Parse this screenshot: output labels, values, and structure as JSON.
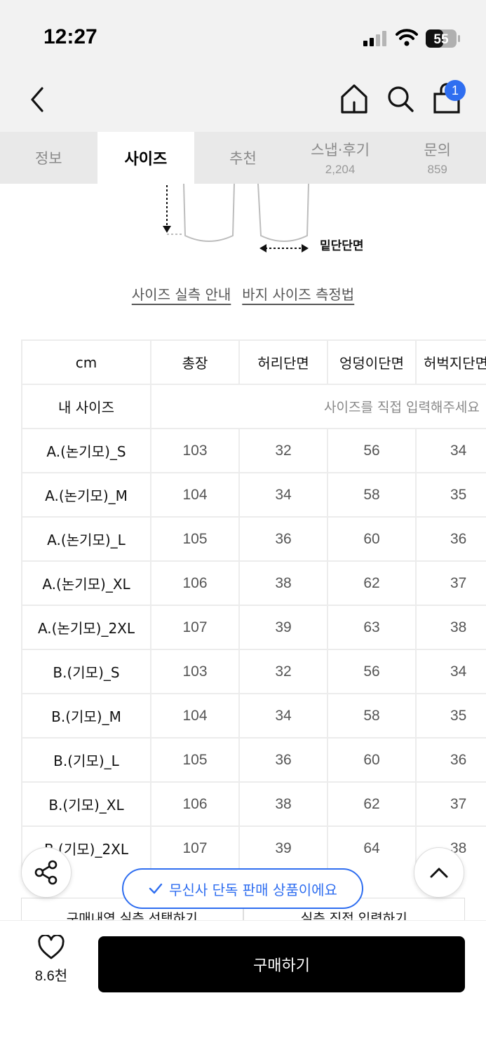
{
  "status": {
    "time": "12:27",
    "battery": "55"
  },
  "nav": {
    "cart_count": "1",
    "icons": [
      "chevron-left-icon",
      "home-icon",
      "search-icon",
      "shopping-bag-icon"
    ]
  },
  "tabs": [
    {
      "label": "정보",
      "count": "",
      "active": false
    },
    {
      "label": "사이즈",
      "count": "",
      "active": true
    },
    {
      "label": "추천",
      "count": "",
      "active": false
    },
    {
      "label": "스냅·후기",
      "count": "2,204",
      "active": false
    },
    {
      "label": "문의",
      "count": "859",
      "active": false
    }
  ],
  "diagram": {
    "hem_label": "밑단단면"
  },
  "guide_links": {
    "size_guide": "사이즈 실측 안내",
    "pants_measure": "바지 사이즈 측정법"
  },
  "size_table": {
    "unit": "cm",
    "columns": [
      "총장",
      "허리단면",
      "엉덩이단면",
      "허벅지단면"
    ],
    "my_size_label": "내 사이즈",
    "my_size_placeholder": "사이즈를 직접 입력해주세요",
    "rows": [
      {
        "size": "A.(논기모)_S",
        "values": [
          "103",
          "32",
          "56",
          "34"
        ]
      },
      {
        "size": "A.(논기모)_M",
        "values": [
          "104",
          "34",
          "58",
          "35"
        ]
      },
      {
        "size": "A.(논기모)_L",
        "values": [
          "105",
          "36",
          "60",
          "36"
        ]
      },
      {
        "size": "A.(논기모)_XL",
        "values": [
          "106",
          "38",
          "62",
          "37"
        ]
      },
      {
        "size": "A.(논기모)_2XL",
        "values": [
          "107",
          "39",
          "63",
          "38"
        ]
      },
      {
        "size": "B.(기모)_S",
        "values": [
          "103",
          "32",
          "56",
          "34"
        ]
      },
      {
        "size": "B.(기모)_M",
        "values": [
          "104",
          "34",
          "58",
          "35"
        ]
      },
      {
        "size": "B.(기모)_L",
        "values": [
          "105",
          "36",
          "60",
          "36"
        ]
      },
      {
        "size": "B.(기모)_XL",
        "values": [
          "106",
          "38",
          "62",
          "37"
        ]
      },
      {
        "size": "B.(기모)_2XL",
        "values": [
          "107",
          "39",
          "64",
          "38"
        ]
      }
    ]
  },
  "floating": {
    "exclusive_text": "무신사 단독 판매 상품이에요",
    "purchase_history_btn": "구매내역 실측 선택하기",
    "direct_input_btn": "실측 직접 입력하기"
  },
  "bottom": {
    "like_count": "8.6천",
    "buy_label": "구매하기"
  },
  "colors": {
    "accent": "#2f6ef0",
    "buy_button": "#000000"
  }
}
